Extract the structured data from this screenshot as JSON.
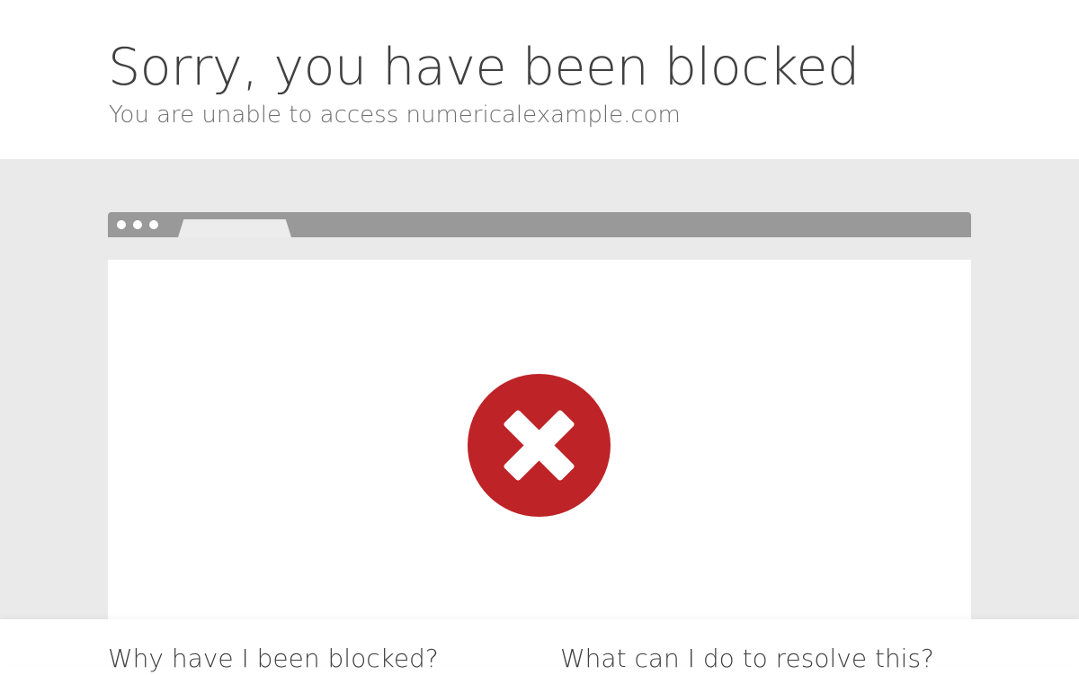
{
  "header": {
    "title": "Sorry, you have been blocked",
    "subtitle": "You are unable to access numericalexample.com"
  },
  "browser": {
    "tab_icon": "browser-tab",
    "status_icon": "blocked-x-icon",
    "status_color": "#be2327"
  },
  "sections": {
    "why_title": "Why have I been blocked?",
    "resolve_title": "What can I do to resolve this?"
  }
}
